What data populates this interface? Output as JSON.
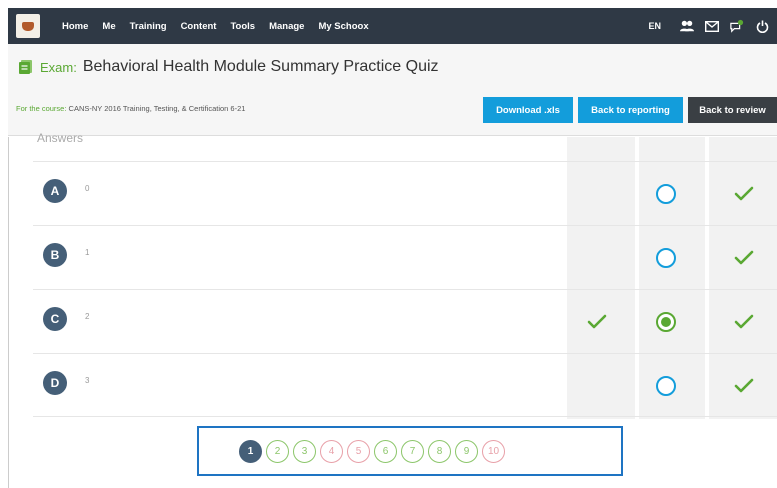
{
  "nav": {
    "items": [
      "Home",
      "Me",
      "Training",
      "Content",
      "Tools",
      "Manage",
      "My Schoox"
    ],
    "lang": "EN"
  },
  "exam": {
    "label": "Exam:",
    "title": "Behavioral Health Module Summary Practice Quiz",
    "course_label": "For the course:",
    "course_name": "CANS-NY 2016 Training, Testing, & Certification 6-21"
  },
  "buttons": {
    "download": "Download .xls",
    "reporting": "Back to reporting",
    "review": "Back to review"
  },
  "answers": {
    "header": "Answers",
    "rows": [
      {
        "letter": "A",
        "value": "0",
        "user_selected": false,
        "user_radio": "unselected",
        "correct_mark": true
      },
      {
        "letter": "B",
        "value": "1",
        "user_selected": false,
        "user_radio": "unselected",
        "correct_mark": true
      },
      {
        "letter": "C",
        "value": "2",
        "user_selected": true,
        "user_radio": "selected",
        "correct_mark": true
      },
      {
        "letter": "D",
        "value": "3",
        "user_selected": false,
        "user_radio": "unselected",
        "correct_mark": true
      }
    ]
  },
  "pagination": {
    "pages": [
      "1",
      "2",
      "3",
      "4",
      "5",
      "6",
      "7",
      "8",
      "9",
      "10"
    ],
    "current": "1",
    "wrong_pages": [
      "4",
      "5",
      "10"
    ]
  },
  "colors": {
    "nav_bg": "#2f3945",
    "accent_blue": "#139ddb",
    "correct_green": "#5aa833",
    "badge_blue": "#455f78",
    "wrong_pink": "#e8a0a8"
  }
}
